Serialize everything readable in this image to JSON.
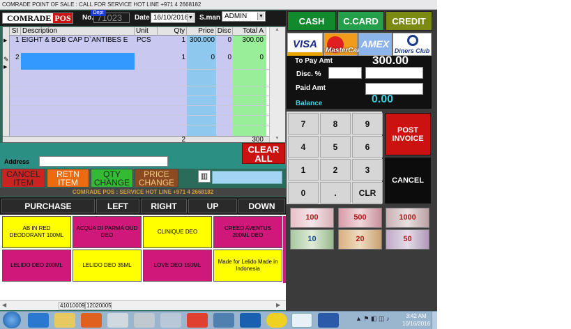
{
  "window": {
    "title": "COMRADE POINT OF SALE : CALL FOR SERVICE HOT LINE  +971 4 2668182"
  },
  "header": {
    "logo_left": "COMRADE",
    "logo_right": "POS",
    "no_label": "No.",
    "dept_badge": "Dept",
    "invoice_no": "71023",
    "date_label": "Date",
    "date_value": "16/10/2016",
    "salesman_label": "S.man",
    "salesman_value": "ADMIN"
  },
  "grid": {
    "columns": [
      "SI",
      "Description",
      "Unit",
      "Qty",
      "Price",
      "Disc",
      "Total A"
    ],
    "rows": [
      {
        "si": "1",
        "description": "EIGHT & BOB CAP D`ANTIBES  E",
        "unit": "PCS",
        "qty": "1",
        "price": "300.000",
        "disc": "0",
        "total": "300.00"
      },
      {
        "si": "2",
        "description": "",
        "unit": "",
        "qty": "1",
        "price": "0",
        "disc": "0",
        "total": "0"
      }
    ],
    "footer_qty": "2",
    "footer_total": "300"
  },
  "address": {
    "label": "Address",
    "value": ""
  },
  "buttons": {
    "clear_all": "CLEAR ALL",
    "cancel_item": "CANCEL ITEM",
    "retn_item": "RETN ITEM",
    "qty_change": "QTY CHANGE",
    "price_change": "PRICE CHANGE"
  },
  "service_strip": "COMRADE POS : SERVICE HOT LINE  +971 4 2668182",
  "nav": [
    "PURCHASE",
    "LEFT",
    "RIGHT",
    "UP",
    "DOWN"
  ],
  "products": [
    {
      "label": "AB IN RED DEODORANT 100ML",
      "color": "yellow"
    },
    {
      "label": "ACQUA DI PARMA OUD DEO",
      "color": "magenta"
    },
    {
      "label": "CLINIQUE DEO",
      "color": "yellow"
    },
    {
      "label": "CREED AVENTUS 200ML DEO",
      "color": "magenta"
    },
    {
      "label": "LELIDO DEO 200ML",
      "color": "magenta"
    },
    {
      "label": "LELIDO DEO 35ML",
      "color": "yellow"
    },
    {
      "label": "LOVE DEO 150ML",
      "color": "magenta"
    },
    {
      "label": "Made for Lelido Made in Indonesia",
      "color": "yellow"
    }
  ],
  "status_codes": [
    "41010009",
    "12020005"
  ],
  "payment": {
    "cash": "CASH",
    "card": "C.CARD",
    "credit": "CREDIT",
    "cards": [
      "VISA",
      "MasterCard",
      "AMEX",
      "Diners Club"
    ]
  },
  "totals": {
    "to_pay_label": "To Pay Amt",
    "to_pay_value": "300.00",
    "disc_label": "Disc. %",
    "paid_label": "Paid Amt",
    "balance_label": "Balance",
    "balance_value": "0.00"
  },
  "keypad": [
    "7",
    "8",
    "9",
    "4",
    "5",
    "6",
    "1",
    "2",
    "3",
    "0",
    ".",
    "CLR"
  ],
  "actions": {
    "post_invoice": "POST INVOICE",
    "cancel": "CANCEL"
  },
  "notes": [
    "100",
    "500",
    "1000",
    "10",
    "20",
    "50"
  ],
  "taskbar": {
    "time": "3:42 AM",
    "date": "10/16/2016"
  }
}
